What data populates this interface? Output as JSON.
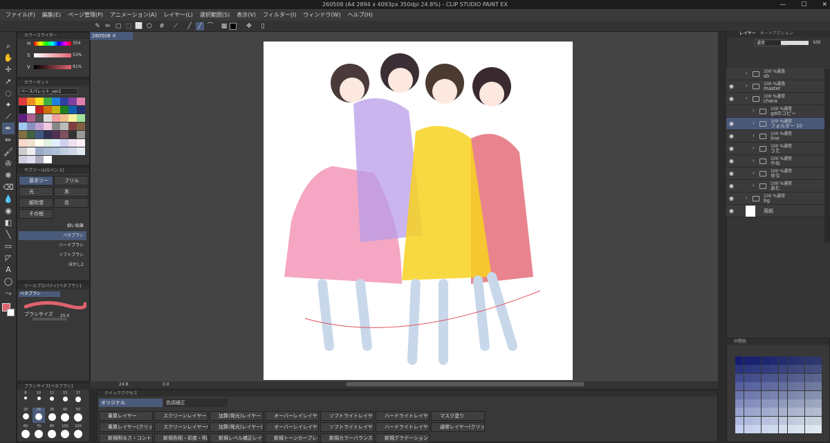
{
  "title": "260508 (A4 2894 x 4093px 350dpi 24.8%) - CLIP STUDIO PAINT EX",
  "window_controls": {
    "min": "—",
    "max": "☐",
    "close": "✕"
  },
  "menu": [
    "ファイル(F)",
    "編集(E)",
    "ページ管理(P)",
    "アニメーション(A)",
    "レイヤー(L)",
    "選択範囲(S)",
    "表示(V)",
    "フィルター(I)",
    "ウィンドウ(W)",
    "ヘルプ(H)"
  ],
  "doc_tab": "260508",
  "color_slider": {
    "title": "カラースライダー",
    "rows": [
      {
        "label": "H",
        "value": "354"
      },
      {
        "label": "S",
        "value": "53%"
      },
      {
        "label": "V",
        "value": "91%"
      }
    ]
  },
  "color_set": {
    "title": "カラーセット",
    "palette_name": "ベースパレット_ver2"
  },
  "subtool": {
    "title": "サブツール[Gペン 2]",
    "items": [
      "基本ツール",
      "フリル",
      "光",
      "氷",
      "紙吹雪",
      "花",
      "その他"
    ],
    "brushes": [
      "細い鉛筆",
      "ベタブラシ",
      "ハードブラシ",
      "ソフトブラシ",
      "ぼかし2"
    ]
  },
  "tool_property": {
    "title": "ツールプロパティ[ベタブラシ]",
    "brush_name": "ベタブラシ",
    "size_label": "ブラシサイズ",
    "size_value": "25.0"
  },
  "brush_size": {
    "title": "ブラシサイズ[ベタブラシ]",
    "sizes": [
      "8",
      "10",
      "12",
      "15",
      "17",
      "20",
      "25",
      "30",
      "40",
      "50",
      "60",
      "70",
      "80",
      "100",
      "120"
    ]
  },
  "status": {
    "zoom": "24.8",
    "rotation": "0.0"
  },
  "quick_access": {
    "title": "クイックアクセス",
    "tabs": [
      "オリジナル",
      "色調補正"
    ],
    "row1": [
      "乗算レイヤー",
      "スクリーンレイヤー",
      "加算(発光)レイヤー",
      "オーバーレイレイヤー",
      "ソフトライトレイヤー",
      "ハードライトレイヤー",
      "マスク塗り"
    ],
    "row2": [
      "乗算レイヤー(クリッピング)",
      "スクリーンレイヤー(クリッピング)",
      "加算(発光)レイヤー(クリッピング)",
      "オーバーレイレイヤー(クリッピング)",
      "ソフトライトレイヤー(クリッピング)",
      "ハードライトレイヤー(クリッピング)",
      "通常レイヤー(クリッピング)"
    ],
    "row3": [
      "新規明るさ・コントラストレイヤー",
      "新規色相・彩度・明度レイヤー",
      "新規レベル補正レイヤー",
      "新規トーンカーブレイヤー",
      "新規カラーバランスレイヤー",
      "新規グラデーションマップレイヤー"
    ]
  },
  "layer_panel": {
    "tabs": [
      "レイヤー",
      "オートアクション"
    ],
    "blend": "通常",
    "opacity": "100",
    "layers": [
      {
        "mode": "100 %通過",
        "name": "sb",
        "type": "folder",
        "indent": 0,
        "visible": false
      },
      {
        "mode": "100 %通過",
        "name": "master",
        "type": "folder",
        "indent": 0,
        "visible": true
      },
      {
        "mode": "100 %通常",
        "name": "chara",
        "type": "folder",
        "indent": 0,
        "visible": true
      },
      {
        "mode": "100 %通常",
        "name": "gdのコピー",
        "type": "folder",
        "indent": 1,
        "visible": false
      },
      {
        "mode": "100 %通常",
        "name": "フォルダー 10",
        "type": "folder",
        "indent": 1,
        "visible": true,
        "selected": true
      },
      {
        "mode": "100 %通常",
        "name": "line",
        "type": "folder",
        "indent": 1,
        "visible": true
      },
      {
        "mode": "100 %通常",
        "name": "うた",
        "type": "folder",
        "indent": 1,
        "visible": true
      },
      {
        "mode": "100 %通常",
        "name": "やね",
        "type": "folder",
        "indent": 1,
        "visible": true
      },
      {
        "mode": "100 %通常",
        "name": "ゆな",
        "type": "folder",
        "indent": 1,
        "visible": true
      },
      {
        "mode": "100 %通常",
        "name": "あむ",
        "type": "folder",
        "indent": 1,
        "visible": true
      },
      {
        "mode": "100 %通常",
        "name": "bg",
        "type": "folder",
        "indent": 0,
        "visible": true
      },
      {
        "mode": "",
        "name": "用紙",
        "type": "paper",
        "indent": 0,
        "visible": true
      }
    ]
  },
  "intermediate_color": {
    "title": "中間色"
  },
  "colors": {
    "accent": "#5a6e9a",
    "current_color": "#e0636f",
    "selected_layer": "#4a5878"
  }
}
